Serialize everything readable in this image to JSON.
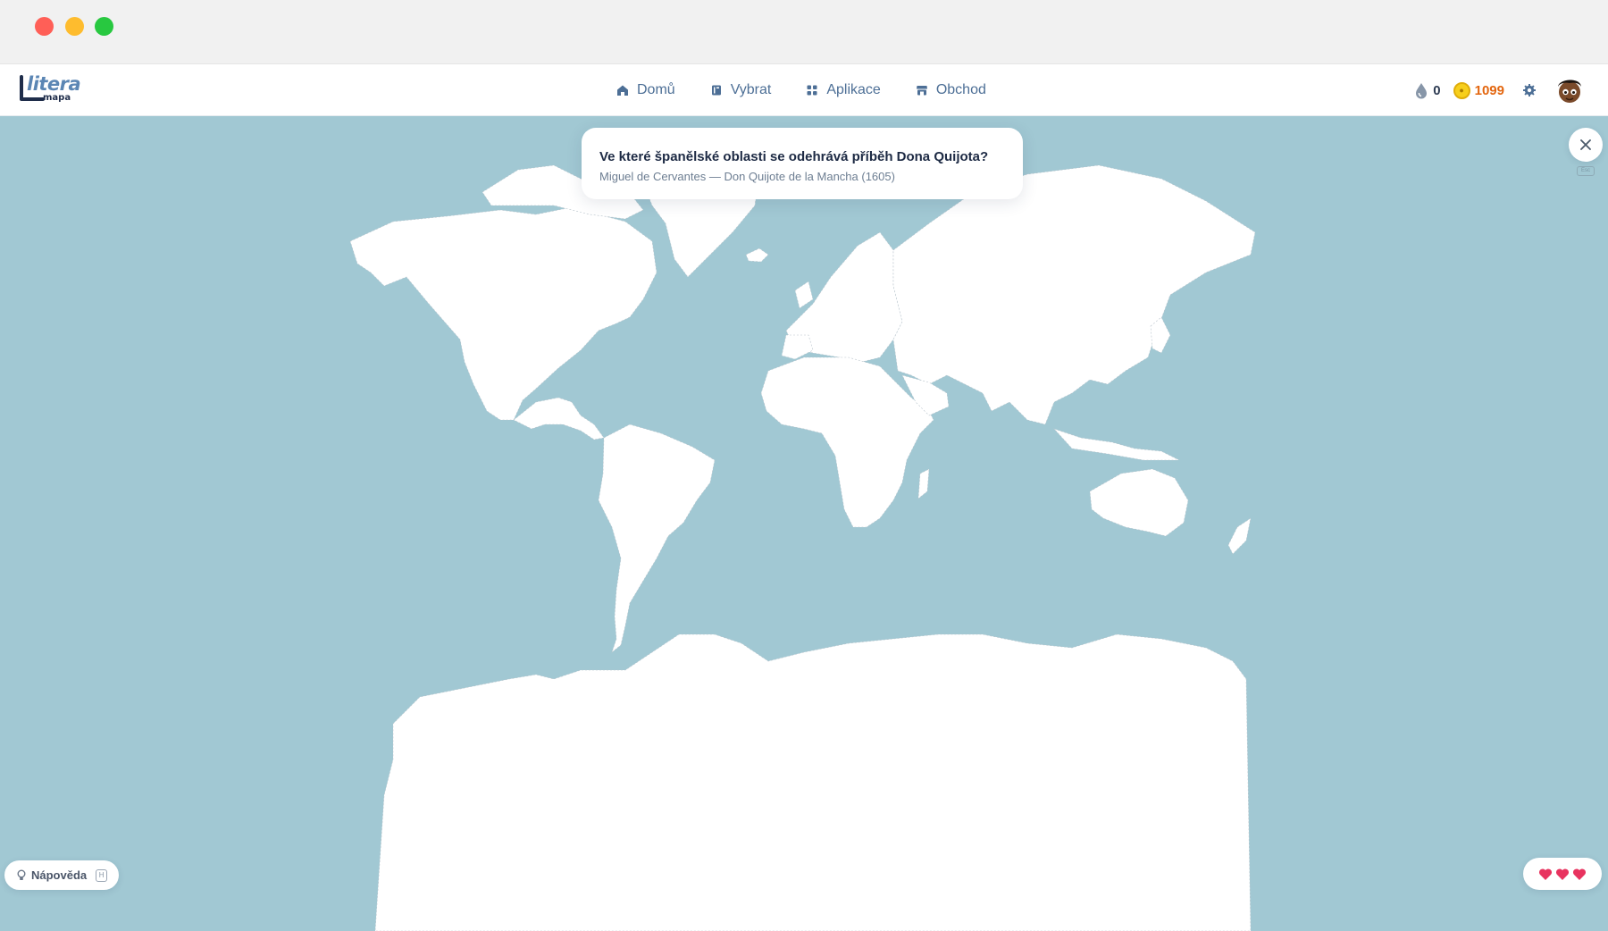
{
  "window": {
    "buttons": [
      "close",
      "minimize",
      "maximize"
    ]
  },
  "brand": {
    "logo_main": "litera",
    "logo_sub": "mapa"
  },
  "nav": {
    "items": [
      {
        "label": "Domů",
        "icon": "home-icon"
      },
      {
        "label": "Vybrat",
        "icon": "book-icon"
      },
      {
        "label": "Aplikace",
        "icon": "grid-icon"
      },
      {
        "label": "Obchod",
        "icon": "store-icon"
      }
    ]
  },
  "stats": {
    "drops": "0",
    "coins": "1099",
    "coin_color": "#f7cf1c",
    "coins_text_color": "#e3660f"
  },
  "question": {
    "text": "Ve které španělské oblasti se odehrává příběh Dona Quijota?",
    "source": "Miguel de Cervantes — Don Quijote de la Mancha (1605)"
  },
  "controls": {
    "close_key": "Esc",
    "hint_label": "Nápověda",
    "hint_key": "H"
  },
  "lives": {
    "count": 3,
    "color": "#e8335f"
  },
  "map": {
    "ocean_color": "#a1c8d3",
    "land_color": "#ffffff"
  }
}
